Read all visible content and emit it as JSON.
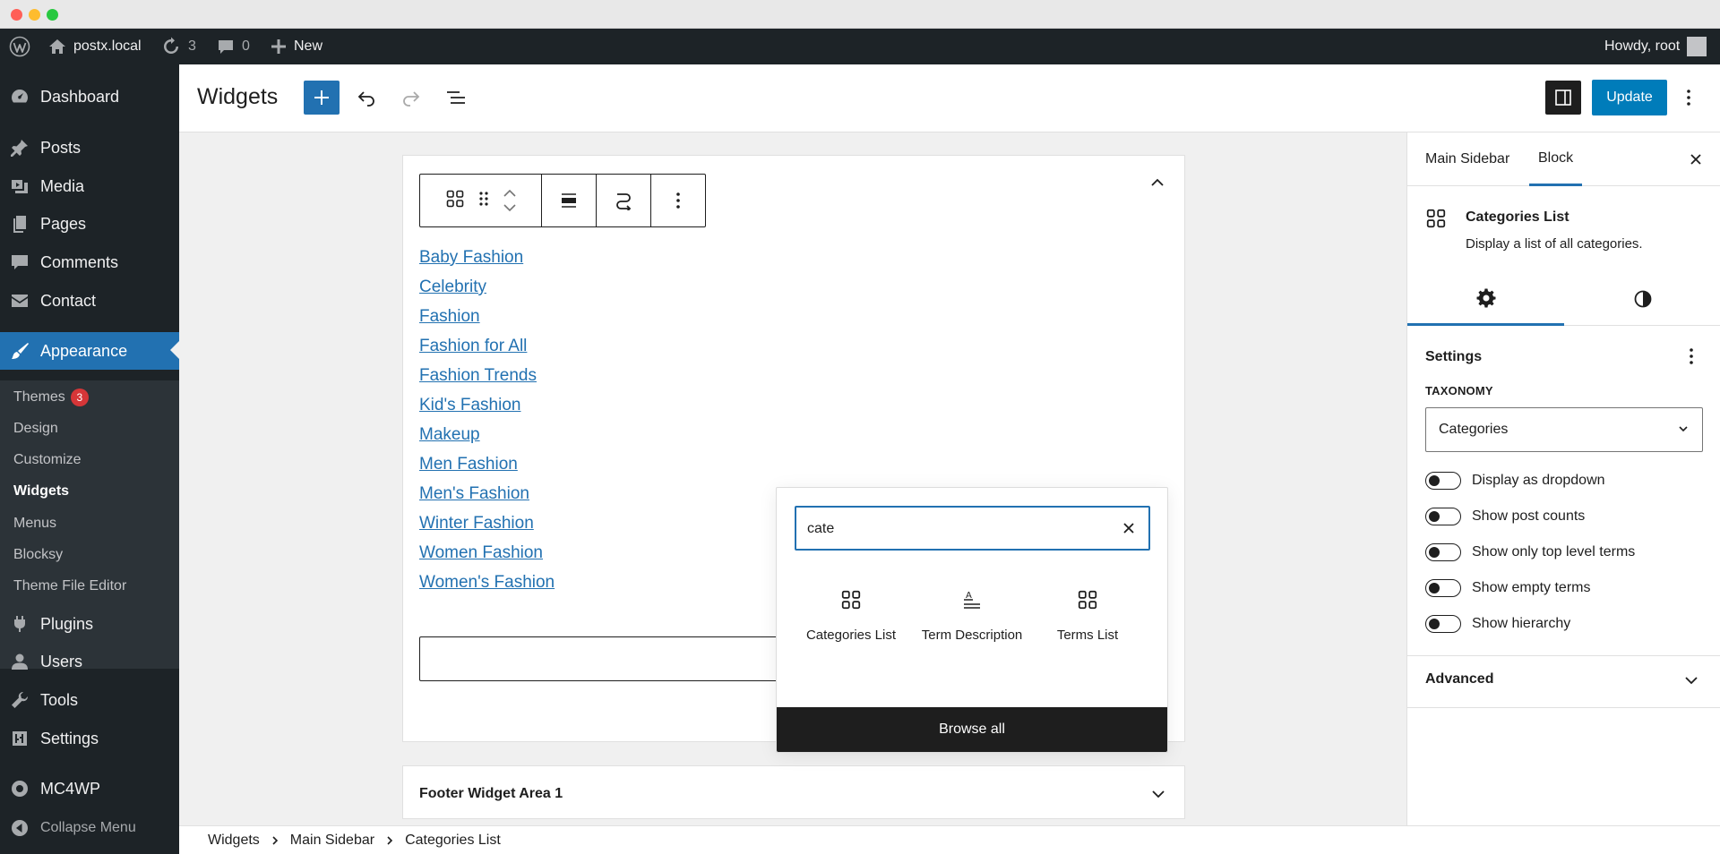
{
  "admin_bar": {
    "site_name": "postx.local",
    "updates_count": "3",
    "comments_count": "0",
    "new_label": "New",
    "howdy": "Howdy, root"
  },
  "sidebar": {
    "items": [
      {
        "label": "Dashboard",
        "icon": "dashboard-icon"
      },
      {
        "label": "Posts",
        "icon": "pin-icon"
      },
      {
        "label": "Media",
        "icon": "media-icon"
      },
      {
        "label": "Pages",
        "icon": "pages-icon"
      },
      {
        "label": "Comments",
        "icon": "comment-icon"
      },
      {
        "label": "Contact",
        "icon": "mail-icon"
      },
      {
        "label": "Appearance",
        "icon": "brush-icon"
      },
      {
        "label": "Plugins",
        "icon": "plugin-icon"
      },
      {
        "label": "Users",
        "icon": "user-icon"
      },
      {
        "label": "Tools",
        "icon": "wrench-icon"
      },
      {
        "label": "Settings",
        "icon": "sliders-icon"
      },
      {
        "label": "MC4WP",
        "icon": "mc4wp-icon"
      },
      {
        "label": "Collapse Menu",
        "icon": "collapse-icon"
      }
    ],
    "submenu": [
      {
        "label": "Themes",
        "badge": "3"
      },
      {
        "label": "Design"
      },
      {
        "label": "Customize"
      },
      {
        "label": "Widgets"
      },
      {
        "label": "Menus"
      },
      {
        "label": "Blocksy"
      },
      {
        "label": "Theme File Editor"
      }
    ]
  },
  "header": {
    "title": "Widgets",
    "update_label": "Update"
  },
  "widget_area": {
    "categories": [
      "Baby Fashion",
      "Celebrity",
      "Fashion",
      "Fashion for All",
      "Fashion Trends",
      "Kid's Fashion",
      "Makeup",
      "Men Fashion",
      "Men's Fashion",
      "Winter Fashion",
      "Women Fashion",
      "Women's Fashion"
    ],
    "footer_title": "Footer Widget Area 1"
  },
  "inserter": {
    "search_value": "cate",
    "results": [
      {
        "label": "Categories List",
        "icon": "grid-icon"
      },
      {
        "label": "Term Description",
        "icon": "term-description-icon"
      },
      {
        "label": "Terms List",
        "icon": "grid-icon"
      }
    ],
    "browse_all": "Browse all"
  },
  "settings": {
    "tabs": [
      "Main Sidebar",
      "Block"
    ],
    "block_title": "Categories List",
    "block_desc": "Display a list of all categories.",
    "panel_title": "Settings",
    "taxonomy_label": "TAXONOMY",
    "taxonomy_value": "Categories",
    "toggles": [
      "Display as dropdown",
      "Show post counts",
      "Show only top level terms",
      "Show empty terms",
      "Show hierarchy"
    ],
    "advanced": "Advanced"
  },
  "breadcrumb": [
    "Widgets",
    "Main Sidebar",
    "Categories List"
  ],
  "colors": {
    "accent": "#2271b1",
    "admin_dark": "#1d2327",
    "badge": "#d63638"
  }
}
